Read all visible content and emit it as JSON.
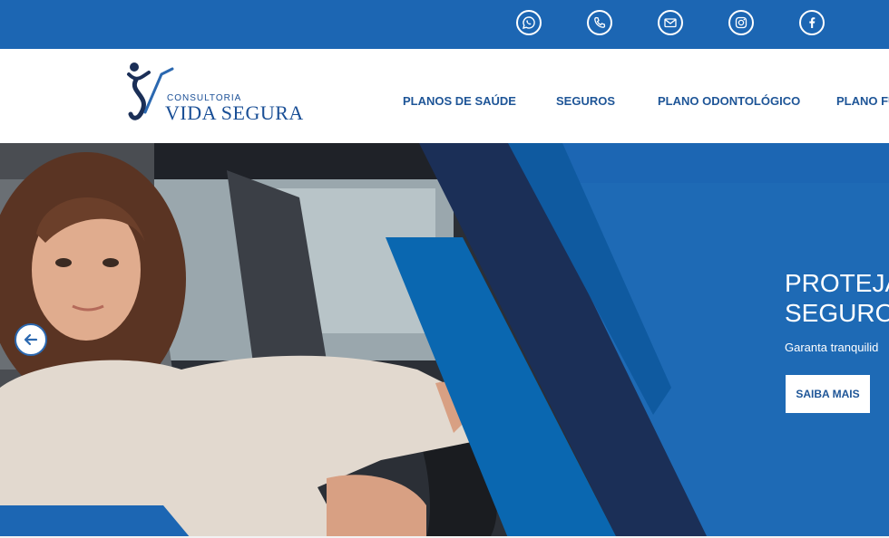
{
  "topbar": {
    "social_icons": [
      "whatsapp-icon",
      "phone-icon",
      "email-icon",
      "instagram-icon",
      "facebook-icon"
    ],
    "color": "#1c66b3"
  },
  "header": {
    "logo": {
      "subtitle": "CONSULTORIA",
      "name": "VIDA SEGURA"
    },
    "nav": [
      "PLANOS DE SAÚDE",
      "SEGUROS",
      "PLANO ODONTOLÓGICO",
      "PLANO FU"
    ]
  },
  "hero": {
    "title": "PROTEJA\nSEGUROS",
    "subtitle": "Garanta tranquilid",
    "button": "SAIBA MAIS",
    "prev_icon": "arrow-left-icon",
    "colors": {
      "primary": "#1c66b3",
      "dark": "#1b2f57",
      "mid": "#0a67b0"
    }
  }
}
